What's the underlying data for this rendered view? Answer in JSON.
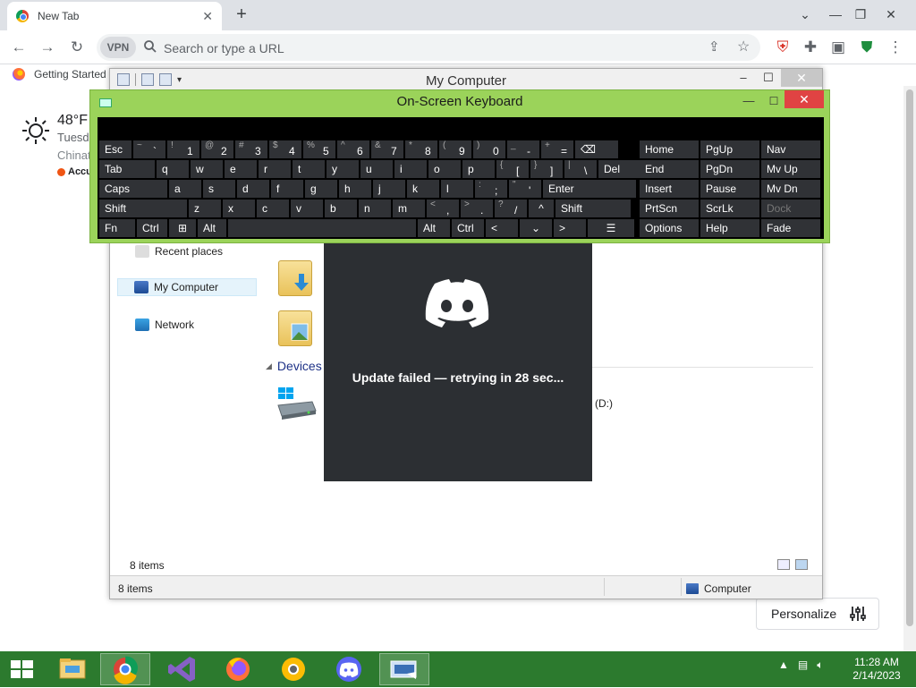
{
  "browser": {
    "tab_title": "New Tab",
    "omnibox_placeholder": "Search or type a URL",
    "vpn_label": "VPN",
    "bookmark": "Getting Started",
    "weather": {
      "temp": "48°F",
      "day": "Tuesd",
      "city": "Chinat",
      "source": "Accu"
    },
    "personalize": "Personalize"
  },
  "explorer": {
    "title": "My Computer",
    "nav": [
      "Recent places",
      "My Computer",
      "Network"
    ],
    "section": "Devices",
    "drive_label": "(D:)",
    "items_count": "8 items",
    "status_items": "8 items",
    "status_location": "Computer"
  },
  "discord": {
    "message": "Update failed — retrying in 28 sec..."
  },
  "osk": {
    "title": "On-Screen Keyboard",
    "rows": [
      [
        {
          "t": "Esc"
        },
        {
          "s": "~",
          "m": "`"
        },
        {
          "s": "!",
          "m": "1"
        },
        {
          "s": "@",
          "m": "2"
        },
        {
          "s": "#",
          "m": "3"
        },
        {
          "s": "$",
          "m": "4"
        },
        {
          "s": "%",
          "m": "5"
        },
        {
          "s": "^",
          "m": "6"
        },
        {
          "s": "&",
          "m": "7"
        },
        {
          "s": "*",
          "m": "8"
        },
        {
          "s": "(",
          "m": "9"
        },
        {
          "s": ")",
          "m": "0"
        },
        {
          "s": "_",
          "m": "-"
        },
        {
          "s": "+",
          "m": "="
        },
        {
          "t": "⌫"
        }
      ],
      [
        {
          "t": "Tab"
        },
        {
          "t": "q"
        },
        {
          "t": "w"
        },
        {
          "t": "e"
        },
        {
          "t": "r"
        },
        {
          "t": "t"
        },
        {
          "t": "y"
        },
        {
          "t": "u"
        },
        {
          "t": "i"
        },
        {
          "t": "o"
        },
        {
          "t": "p"
        },
        {
          "s": "{",
          "m": "["
        },
        {
          "s": "}",
          "m": "]"
        },
        {
          "s": "|",
          "m": "\\"
        },
        {
          "t": "Del"
        }
      ],
      [
        {
          "t": "Caps"
        },
        {
          "t": "a"
        },
        {
          "t": "s"
        },
        {
          "t": "d"
        },
        {
          "t": "f"
        },
        {
          "t": "g"
        },
        {
          "t": "h"
        },
        {
          "t": "j"
        },
        {
          "t": "k"
        },
        {
          "t": "l"
        },
        {
          "s": ":",
          "m": ";"
        },
        {
          "s": "\"",
          "m": "'"
        },
        {
          "t": "Enter"
        }
      ],
      [
        {
          "t": "Shift"
        },
        {
          "t": "z"
        },
        {
          "t": "x"
        },
        {
          "t": "c"
        },
        {
          "t": "v"
        },
        {
          "t": "b"
        },
        {
          "t": "n"
        },
        {
          "t": "m"
        },
        {
          "s": "<",
          "m": ","
        },
        {
          "s": ">",
          "m": "."
        },
        {
          "s": "?",
          "m": "/"
        },
        {
          "t": "^"
        },
        {
          "t": "Shift"
        }
      ],
      [
        {
          "t": "Fn"
        },
        {
          "t": "Ctrl"
        },
        {
          "t": "⊞"
        },
        {
          "t": "Alt"
        },
        {
          "t": ""
        },
        {
          "t": "Alt"
        },
        {
          "t": "Ctrl"
        },
        {
          "t": "<"
        },
        {
          "t": "⌄"
        },
        {
          "t": ">"
        },
        {
          "t": "☰"
        }
      ]
    ],
    "right": [
      [
        "Home",
        "PgUp",
        "Nav"
      ],
      [
        "End",
        "PgDn",
        "Mv Up"
      ],
      [
        "Insert",
        "Pause",
        "Mv Dn"
      ],
      [
        "PrtScn",
        "ScrLk",
        "Dock"
      ],
      [
        "Options",
        "Help",
        "Fade"
      ]
    ]
  },
  "taskbar": {
    "time": "11:28 AM",
    "date": "2/14/2023"
  },
  "colors": {
    "taskbar": "#2c7a2e",
    "osk_frame": "#9bd35a",
    "discord_bg": "#2c2f33",
    "discord_blurple": "#ffffff"
  }
}
